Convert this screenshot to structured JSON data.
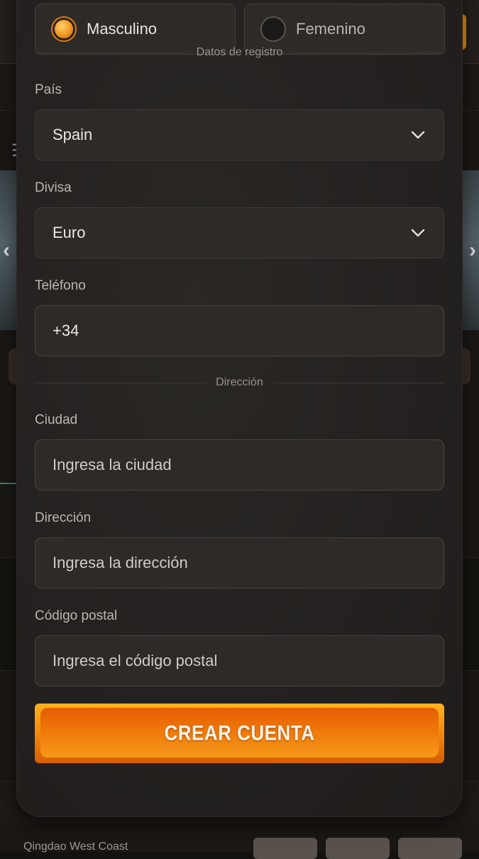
{
  "background": {
    "fixture_team": "Qingdao West Coast"
  },
  "form": {
    "gender": {
      "male_label": "Masculino",
      "female_label": "Femenino",
      "selected": "Masculino"
    },
    "section_registration": "Datos de registro",
    "country": {
      "label": "País",
      "value": "Spain"
    },
    "currency": {
      "label": "Divisa",
      "value": "Euro"
    },
    "phone": {
      "label": "Teléfono",
      "value": "+34"
    },
    "section_address": "Dirección",
    "city": {
      "label": "Ciudad",
      "placeholder": "Ingresa la ciudad"
    },
    "address": {
      "label": "Dirección",
      "placeholder": "Ingresa la dirección"
    },
    "postal": {
      "label": "Código postal",
      "placeholder": "Ingresa el código postal"
    },
    "submit_label": "CREAR CUENTA"
  },
  "colors": {
    "accent_orange": "#f08a0a",
    "modal_bg": "#242120",
    "field_bg": "#2d2a27"
  }
}
